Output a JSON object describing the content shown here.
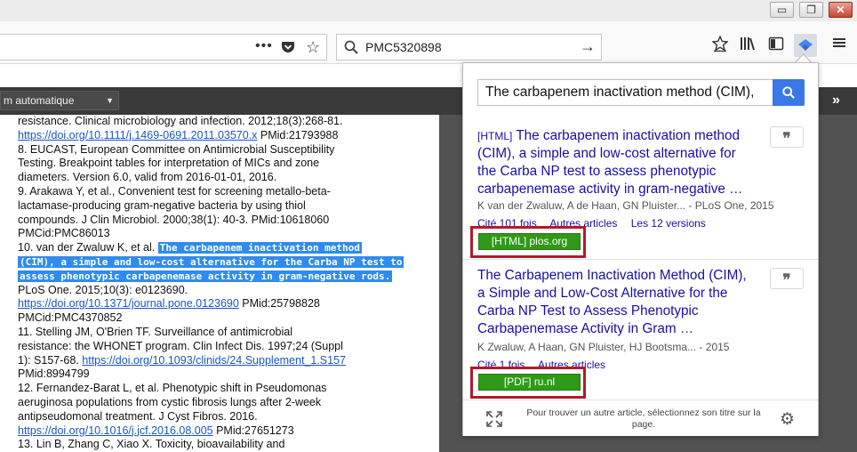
{
  "window": {
    "min_label": "▭",
    "max_label": "❐",
    "close_label": "✕"
  },
  "toolbar": {
    "url_dots": "•••",
    "search_value": "PMC5320898",
    "go_label": "→",
    "icons": [
      "bookmark-add-icon",
      "library-icon",
      "sidebar-icon",
      "scholar-extension-icon",
      "menu-icon"
    ]
  },
  "reader": {
    "zoom_label": "m automatique",
    "expand_label": "»"
  },
  "document": {
    "lines": [
      {
        "text": "resistance. Clinical microbiology and infection. 2012;18(3):268-81.",
        "type": "text"
      },
      {
        "link": "https://doi.org/10.1111/j.1469-0691.2011.03570.x",
        "after": " PMid:21793988",
        "type": "linkline"
      },
      {
        "text": "8. EUCAST, European Committee on Antimicrobial Susceptibility",
        "type": "text"
      },
      {
        "text": "Testing. Breakpoint tables for interpretation of MICs and zone",
        "type": "text"
      },
      {
        "text": "diameters. Version 6.0, valid from 2016-01-01, 2016.",
        "type": "text"
      },
      {
        "text": "9. Arakawa Y, et al., Convenient test for screening metallo-beta-",
        "type": "text"
      },
      {
        "text": "lactamase-producing gram-negative bacteria by using thiol",
        "type": "text"
      },
      {
        "text": "compounds. J Clin Microbiol. 2000;38(1): 40-3. PMid:10618060",
        "type": "text"
      },
      {
        "text": "PMCid:PMC86013",
        "type": "text"
      },
      {
        "text": "10. van der Zwaluw K, et al. ",
        "highlight": "The carbapenem inactivation method",
        "type": "hlline"
      },
      {
        "highlight": "(CIM), a simple and low-cost alternative for the Carba NP test to",
        "type": "hlonly"
      },
      {
        "highlight": "assess phenotypic carbapenemase activity in gram-negative rods.",
        "type": "hlonly"
      },
      {
        "text": "PLoS One. 2015;10(3): e0123690.",
        "type": "text"
      },
      {
        "link": "https://doi.org/10.1371/journal.pone.0123690",
        "after": " PMid:25798828",
        "type": "linkline"
      },
      {
        "text": "PMCid:PMC4370852",
        "type": "text"
      },
      {
        "text": "11. Stelling JM, O'Brien TF. Surveillance of antimicrobial",
        "type": "text"
      },
      {
        "text": "resistance: the WHONET program. Clin Infect Dis. 1997;24 (Suppl",
        "type": "text"
      },
      {
        "before": "1): S157-68. ",
        "link": "https://doi.org/10.1093/clinids/24.Supplement_1.S157",
        "type": "linkline"
      },
      {
        "text": "PMid:8994799",
        "type": "text"
      },
      {
        "text": "12. Fernandez-Barat L, et al. Phenotypic shift in Pseudomonas",
        "type": "text"
      },
      {
        "text": "aeruginosa populations from cystic fibrosis lungs after 2-week",
        "type": "text"
      },
      {
        "text": "antipseudomonal treatment. J Cyst Fibros. 2016.",
        "type": "text"
      },
      {
        "link": "https://doi.org/10.1016/j.jcf.2016.08.005",
        "after": " PMid:27651273",
        "type": "linkline"
      },
      {
        "text": "13. Lin B, Zhang C, Xiao X. Toxicity, bioavailability and",
        "type": "text"
      }
    ]
  },
  "popup": {
    "search_value": "The carbapenem inactivation method (CIM),",
    "results": [
      {
        "tag": "[HTML]",
        "title_lines": [
          " The carbapenem inactivation method",
          "(CIM), a simple and low-cost alternative for",
          "the Carba NP test to assess phenotypic",
          "carbapenemase activity in gram-negative …"
        ],
        "authors": "K van der Zwaluw, A de Haan, GN Pluister... - PLoS One, 2015",
        "links": [
          "Cité 101 fois",
          "Autres articles",
          "Les 12 versions"
        ],
        "fulltext": "[HTML] plos.org",
        "cite_label": "❞"
      },
      {
        "tag": "",
        "title_lines": [
          "The Carbapenem Inactivation Method (CIM),",
          "a Simple and Low-Cost Alternative for the",
          "Carba NP Test to Assess Phenotypic",
          "Carbapenemase Activity in Gram …"
        ],
        "authors": "K Zwaluw, A Haan, GN Pluister, HJ Bootsma... - 2015",
        "links": [
          "Cité 1 fois",
          "Autres articles"
        ],
        "fulltext": "[PDF] ru.nl",
        "cite_label": "❞"
      }
    ],
    "footer_text": "Pour trouver un autre article, sélectionnez son titre sur la page."
  }
}
